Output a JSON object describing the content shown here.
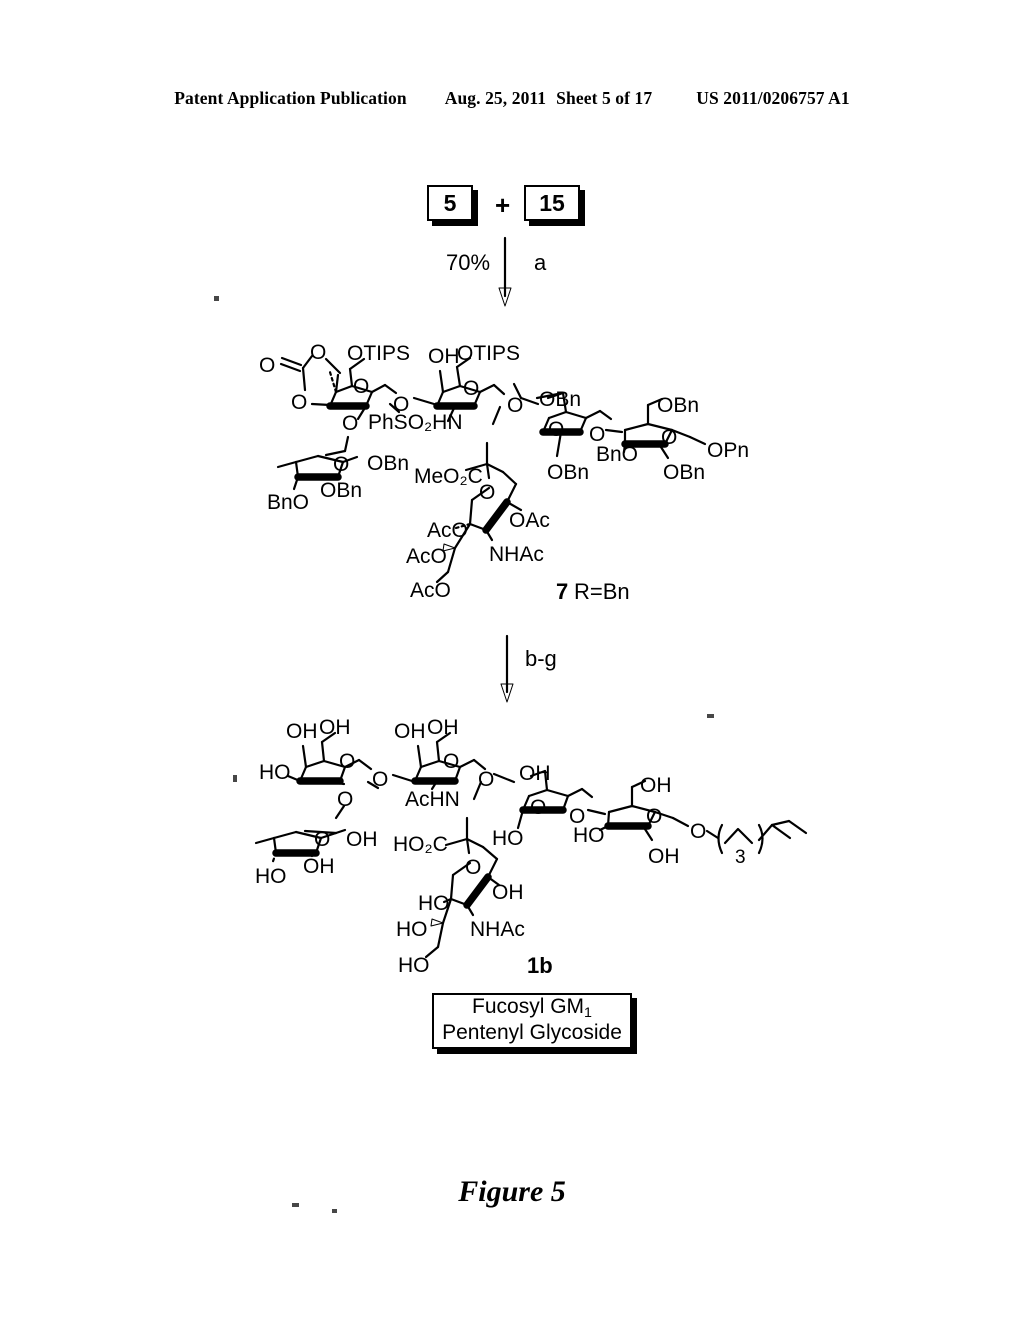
{
  "header": {
    "publication": "Patent Application Publication",
    "date": "Aug. 25, 2011",
    "sheet": "Sheet 5 of 17",
    "patent_number": "US 2011/0206757 A1"
  },
  "scheme": {
    "reactant_box_1": "5",
    "plus_sign": "+",
    "reactant_box_2": "15",
    "arrow1_yield": "70%",
    "arrow1_conditions": "a",
    "arrow2_conditions": "b-g"
  },
  "structure7": {
    "compound_number": "7",
    "r_group": "R=Bn",
    "labels": [
      {
        "id": "carbonate-O-double",
        "text": "O"
      },
      {
        "id": "carbonate-O-top",
        "text": "O"
      },
      {
        "id": "carbonate-O-bottom",
        "text": "O"
      },
      {
        "id": "gal-otips-1",
        "text": "OTIPS"
      },
      {
        "id": "gal-ring-O-1",
        "text": "O"
      },
      {
        "id": "fuc-link-O",
        "text": "O"
      },
      {
        "id": "interglyc-O-1",
        "text": "O"
      },
      {
        "id": "galnac-oh",
        "text": "OH"
      },
      {
        "id": "galnac-otips",
        "text": "OTIPS"
      },
      {
        "id": "galnac-ring-O",
        "text": "O"
      },
      {
        "id": "phso2hn",
        "text": "PhSO₂HN"
      },
      {
        "id": "interglyc-O-2",
        "text": "O"
      },
      {
        "id": "gal2-obn-top",
        "text": "OBn"
      },
      {
        "id": "gal2-ring-O",
        "text": "O"
      },
      {
        "id": "interglyc-O-3",
        "text": "O"
      },
      {
        "id": "gal2-obn-bottom",
        "text": "OBn"
      },
      {
        "id": "glc-obn-top",
        "text": "OBn"
      },
      {
        "id": "glc-ring-O",
        "text": "O"
      },
      {
        "id": "glc-bno",
        "text": "BnO"
      },
      {
        "id": "glc-obn-bottom",
        "text": "OBn"
      },
      {
        "id": "opn",
        "text": "OPn"
      },
      {
        "id": "fuc-ring-O",
        "text": "O"
      },
      {
        "id": "fuc-obn-right",
        "text": "OBn"
      },
      {
        "id": "fuc-obn-bottom",
        "text": "OBn"
      },
      {
        "id": "fuc-bno",
        "text": "BnO"
      },
      {
        "id": "sia-meo2c",
        "text": "MeO₂C"
      },
      {
        "id": "sia-ring-O",
        "text": "O"
      },
      {
        "id": "sia-oac-1",
        "text": "OAc"
      },
      {
        "id": "sia-aco-1",
        "text": "AcO"
      },
      {
        "id": "sia-aco-2",
        "text": "AcO"
      },
      {
        "id": "sia-nhac",
        "text": "NHAc"
      },
      {
        "id": "sia-aco-3",
        "text": "AcO"
      }
    ]
  },
  "structure1b": {
    "compound_number": "1b",
    "labels": [
      {
        "id": "gal-oh-1",
        "text": "OH"
      },
      {
        "id": "gal-oh-2",
        "text": "OH"
      },
      {
        "id": "gal-ho",
        "text": "HO"
      },
      {
        "id": "gal-ring-O",
        "text": "O"
      },
      {
        "id": "fuc-link-O",
        "text": "O"
      },
      {
        "id": "interglyc-O-1",
        "text": "O"
      },
      {
        "id": "galnac-oh-1",
        "text": "OH"
      },
      {
        "id": "galnac-oh-2",
        "text": "OH"
      },
      {
        "id": "galnac-ring-O",
        "text": "O"
      },
      {
        "id": "achn",
        "text": "AcHN"
      },
      {
        "id": "interglyc-O-2",
        "text": "O"
      },
      {
        "id": "gal2-oh-top",
        "text": "OH"
      },
      {
        "id": "gal2-ring-O",
        "text": "O"
      },
      {
        "id": "gal2-ho",
        "text": "HO"
      },
      {
        "id": "interglyc-O-3",
        "text": "O"
      },
      {
        "id": "glc-oh-top",
        "text": "OH"
      },
      {
        "id": "glc-ring-O",
        "text": "O"
      },
      {
        "id": "glc-ho",
        "text": "HO"
      },
      {
        "id": "glc-oh-bottom",
        "text": "OH"
      },
      {
        "id": "anomeric-O",
        "text": "O"
      },
      {
        "id": "chain-repeat",
        "text": "3"
      },
      {
        "id": "fuc-ring-O",
        "text": "O"
      },
      {
        "id": "fuc-oh-right",
        "text": "OH"
      },
      {
        "id": "fuc-oh-bottom",
        "text": "OH"
      },
      {
        "id": "fuc-ho",
        "text": "HO"
      },
      {
        "id": "sia-ho2c",
        "text": "HO₂C"
      },
      {
        "id": "sia-ring-O",
        "text": "O"
      },
      {
        "id": "sia-oh-1",
        "text": "OH"
      },
      {
        "id": "sia-ho-1",
        "text": "HO"
      },
      {
        "id": "sia-ho-2",
        "text": "HO"
      },
      {
        "id": "sia-nhac",
        "text": "NHAc"
      },
      {
        "id": "sia-ho-3",
        "text": "HO"
      }
    ]
  },
  "product_caption": {
    "line1_prefix": "Fucosyl GM",
    "line1_subscript": "1",
    "line2": "Pentenyl Glycoside"
  },
  "figure_caption": "Figure 5"
}
